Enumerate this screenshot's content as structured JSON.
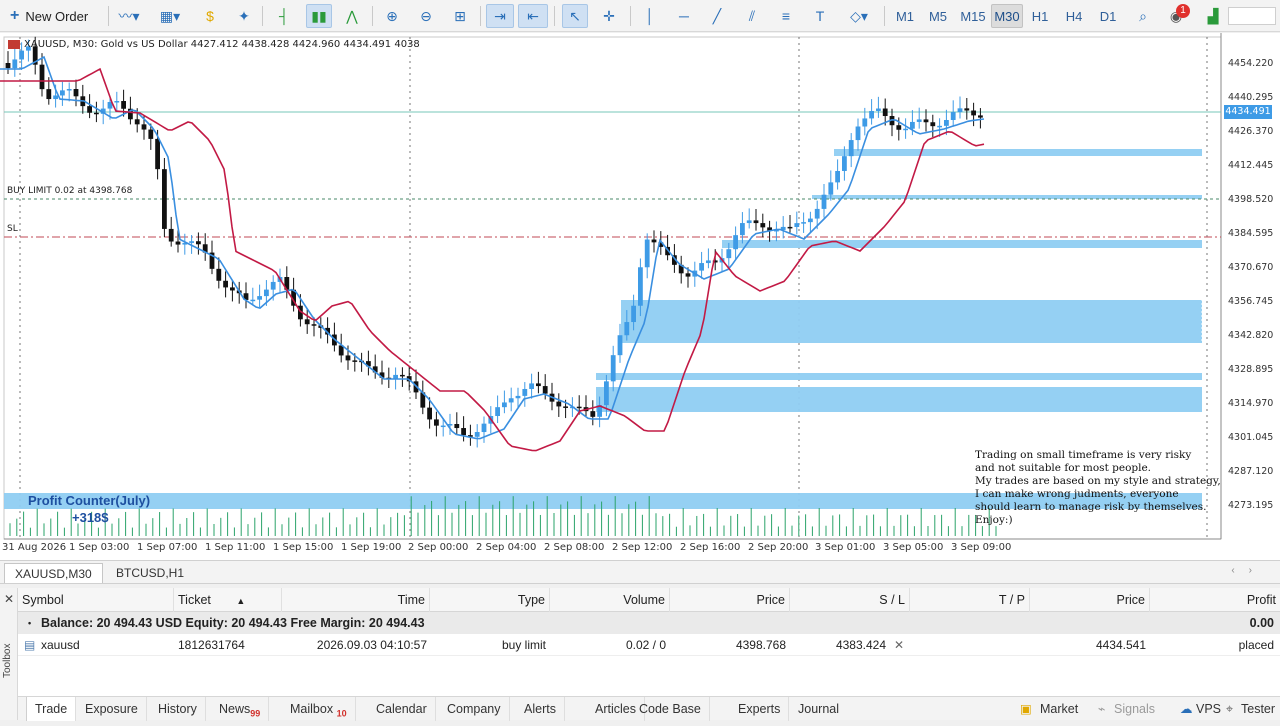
{
  "toolbar": {
    "new_order": "New Order",
    "timeframes": [
      "M1",
      "M5",
      "M15",
      "M30",
      "H1",
      "H4",
      "D1"
    ],
    "active_timeframe": "M30",
    "notification_count": "1"
  },
  "chart": {
    "title": "XAUUSD, M30:  Gold vs US Dollar  4427.412 4438.428 4424.960 4434.491  4038",
    "buy_limit_label": "BUY LIMIT 0.02 at 4398.768",
    "sl_label": "SL",
    "current_price": "4434.491",
    "price_labels": [
      "4454.220",
      "4440.295",
      "4426.370",
      "4412.445",
      "4398.520",
      "4384.595",
      "4370.670",
      "4356.745",
      "4342.820",
      "4328.895",
      "4314.970",
      "4301.045",
      "4287.120",
      "4273.195"
    ],
    "time_labels": [
      "31 Aug 2026",
      "1 Sep 03:00",
      "1 Sep 07:00",
      "1 Sep 11:00",
      "1 Sep 15:00",
      "1 Sep 19:00",
      "2 Sep 00:00",
      "2 Sep 04:00",
      "2 Sep 08:00",
      "2 Sep 12:00",
      "2 Sep 16:00",
      "2 Sep 20:00",
      "3 Sep 01:00",
      "3 Sep 05:00",
      "3 Sep 09:00"
    ],
    "profit_counter_title": "Profit Counter(July)",
    "profit_counter_value": "+318$",
    "notes": [
      "Trading on small timeframe is very risky",
      "and not suitable for most people.",
      "My trades are based on my style and strategy,",
      "I can make wrong judments, everyone",
      "should learn to manage risk by themselves.",
      "Enjoy:)"
    ],
    "colors": {
      "bull": "#3e9be6",
      "bear": "#111111",
      "ma_fast": "#3a8fe0",
      "ma_slow": "#c21a45",
      "zone": "#8fcdf2"
    }
  },
  "chart_tabs": [
    {
      "label": "XAUUSD,M30",
      "active": true
    },
    {
      "label": "BTCUSD,H1",
      "active": false
    }
  ],
  "trade": {
    "columns": [
      "Symbol",
      "Ticket",
      "Time",
      "Type",
      "Volume",
      "Price",
      "S / L",
      "T / P",
      "Price",
      "Profit"
    ],
    "balance_text": "Balance: 20 494.43 USD  Equity: 20 494.43  Free Margin: 20 494.43",
    "balance_profit": "0.00",
    "orders": [
      {
        "symbol": "xauusd",
        "ticket": "1812631764",
        "time": "2026.09.03 04:10:57",
        "type": "buy limit",
        "volume": "0.02 / 0",
        "price": "4398.768",
        "sl": "4383.424",
        "tp": "",
        "current": "4434.541",
        "profit": "placed"
      }
    ]
  },
  "bottom_tabs": [
    {
      "label": "Trade",
      "badge": ""
    },
    {
      "label": "Exposure",
      "badge": ""
    },
    {
      "label": "History",
      "badge": ""
    },
    {
      "label": "News",
      "badge": "99"
    },
    {
      "label": "Mailbox",
      "badge": "10"
    },
    {
      "label": "Calendar",
      "badge": ""
    },
    {
      "label": "Company",
      "badge": ""
    },
    {
      "label": "Alerts",
      "badge": ""
    },
    {
      "label": "Articles",
      "badge": ""
    },
    {
      "label": "Code Base",
      "badge": ""
    },
    {
      "label": "Experts",
      "badge": ""
    },
    {
      "label": "Journal",
      "badge": ""
    }
  ],
  "right_tabs": [
    "Market",
    "Signals",
    "VPS",
    "Tester"
  ],
  "toolbox_label": "Toolbox"
}
